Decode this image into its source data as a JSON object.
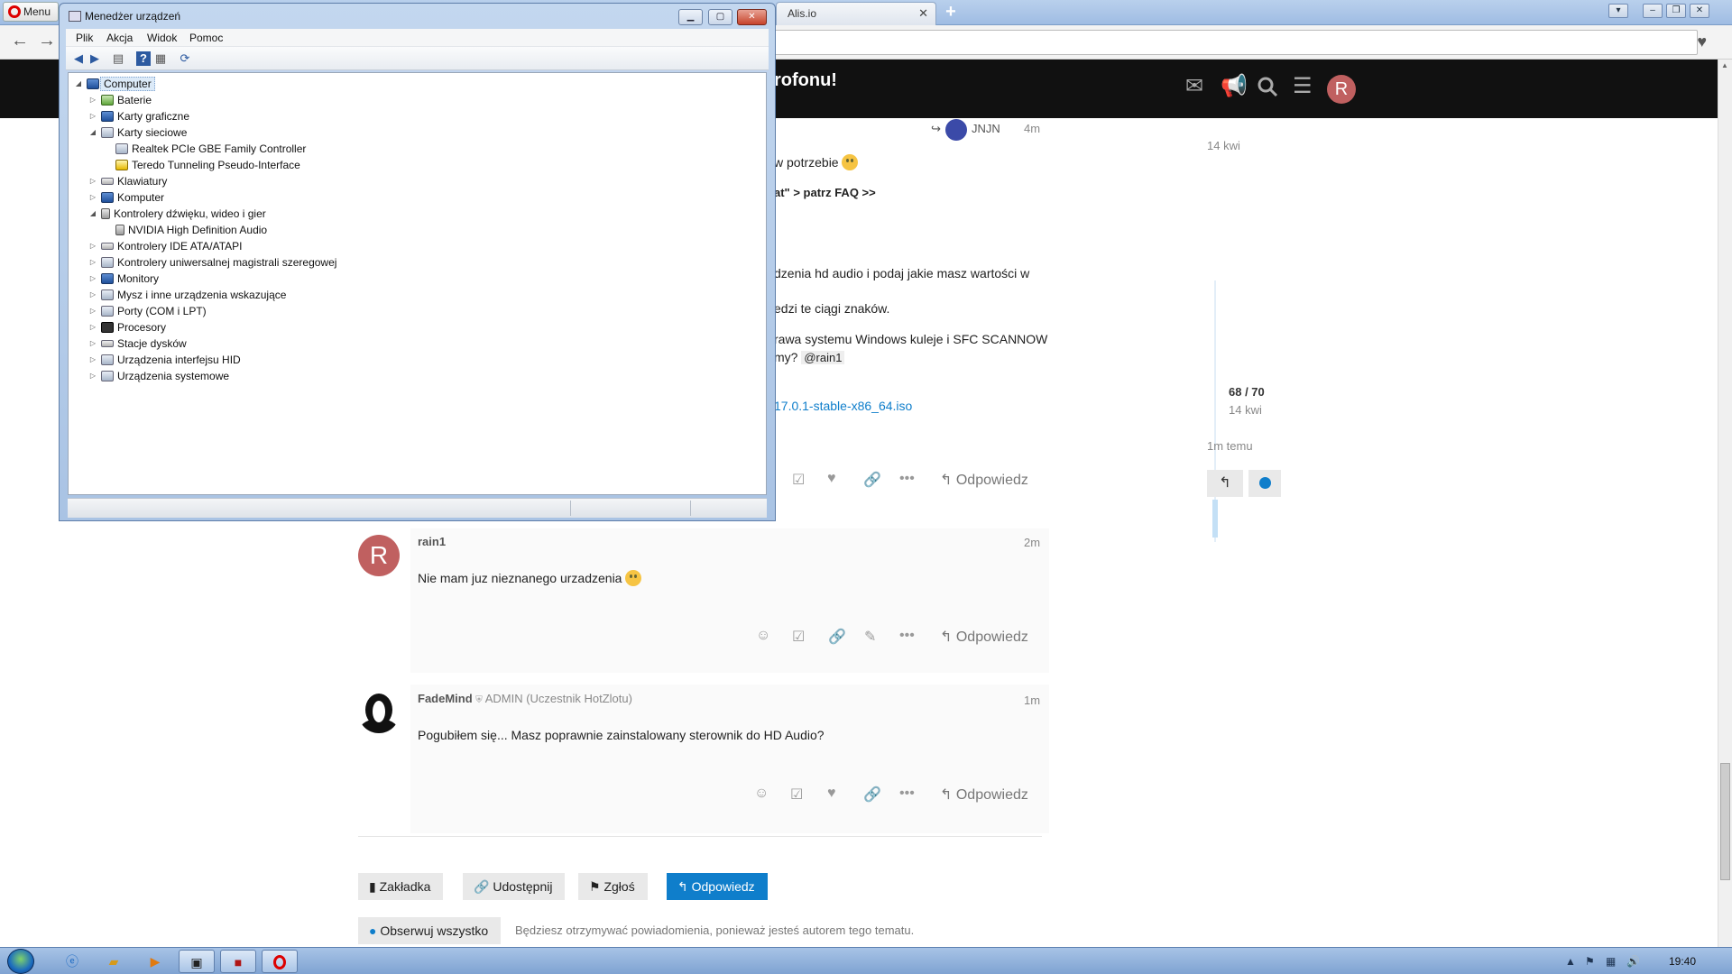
{
  "browser": {
    "menu_label": "Menu",
    "tabs": [
      {
        "title": ""
      },
      {
        "title": "Alis.io"
      }
    ],
    "newtab_label": "+"
  },
  "forum": {
    "topic_title": "rofonu!",
    "avatar_letter": "R",
    "first_post": {
      "user": "JNJN",
      "age": "4m",
      "lines": [
        "w potrzebie",
        "at\" > patrz FAQ >>",
        "dzenia hd audio i podaj jakie masz wartości w",
        "edzi te ciągi znaków.",
        "rawa systemu Windows kuleje i SFC SCANNOW",
        "my?"
      ],
      "mention": "@rain1",
      "link": "17.0.1-stable-x86_64.iso",
      "reply_label": "Odpowiedz"
    },
    "posts": [
      {
        "avatar": "R",
        "user": "rain1",
        "role": "",
        "age": "2m",
        "text": "Nie mam juz nieznanego urzadzenia",
        "reply_label": "Odpowiedz"
      },
      {
        "avatar": "",
        "user": "FadeMind",
        "role": "ADMIN (Uczestnik HotZlotu)",
        "age": "1m",
        "text": "Pogubiłem się... Masz poprawnie zainstalowany sterownik do HD Audio?",
        "reply_label": "Odpowiedz"
      }
    ],
    "footer_buttons": {
      "bookmark": "Zakładka",
      "share": "Udostępnij",
      "flag": "Zgłoś",
      "reply": "Odpowiedz"
    },
    "watch_button": "Obserwuj wszystko",
    "watch_note": "Będziesz otrzymywać powiadomienia, ponieważ jesteś autorem tego tematu."
  },
  "timeline": {
    "top_date": "14 kwi",
    "position": "68 / 70",
    "position_date": "14 kwi",
    "last_activity": "1m temu"
  },
  "device_manager": {
    "title": "Menedżer urządzeń",
    "menu": [
      "Plik",
      "Akcja",
      "Widok",
      "Pomoc"
    ],
    "tree": [
      {
        "label": "Computer",
        "level": 0,
        "toggle": "◢",
        "icon": "computer-icon"
      },
      {
        "label": "Baterie",
        "level": 1,
        "toggle": "▷",
        "icon": "battery-icon"
      },
      {
        "label": "Karty graficzne",
        "level": 1,
        "toggle": "▷",
        "icon": "display-adapter-icon"
      },
      {
        "label": "Karty sieciowe",
        "level": 1,
        "toggle": "◢",
        "icon": "network-adapter-icon"
      },
      {
        "label": "Realtek PCIe GBE Family Controller",
        "level": 2,
        "toggle": "",
        "icon": "network-adapter-icon"
      },
      {
        "label": "Teredo Tunneling Pseudo-Interface",
        "level": 2,
        "toggle": "",
        "icon": "network-warning-icon"
      },
      {
        "label": "Klawiatury",
        "level": 1,
        "toggle": "▷",
        "icon": "keyboard-icon"
      },
      {
        "label": "Komputer",
        "level": 1,
        "toggle": "▷",
        "icon": "computer-icon"
      },
      {
        "label": "Kontrolery dźwięku, wideo i gier",
        "level": 1,
        "toggle": "◢",
        "icon": "speaker-icon"
      },
      {
        "label": "NVIDIA High Definition Audio",
        "level": 2,
        "toggle": "",
        "icon": "speaker-icon"
      },
      {
        "label": "Kontrolery IDE ATA/ATAPI",
        "level": 1,
        "toggle": "▷",
        "icon": "ide-controller-icon"
      },
      {
        "label": "Kontrolery uniwersalnej magistrali szeregowej",
        "level": 1,
        "toggle": "▷",
        "icon": "usb-icon"
      },
      {
        "label": "Monitory",
        "level": 1,
        "toggle": "▷",
        "icon": "monitor-icon"
      },
      {
        "label": "Mysz i inne urządzenia wskazujące",
        "level": 1,
        "toggle": "▷",
        "icon": "mouse-icon"
      },
      {
        "label": "Porty (COM i LPT)",
        "level": 1,
        "toggle": "▷",
        "icon": "port-icon"
      },
      {
        "label": "Procesory",
        "level": 1,
        "toggle": "▷",
        "icon": "processor-icon"
      },
      {
        "label": "Stacje dysków",
        "level": 1,
        "toggle": "▷",
        "icon": "disk-drive-icon"
      },
      {
        "label": "Urządzenia interfejsu HID",
        "level": 1,
        "toggle": "▷",
        "icon": "hid-icon"
      },
      {
        "label": "Urządzenia systemowe",
        "level": 1,
        "toggle": "▷",
        "icon": "system-device-icon"
      }
    ]
  },
  "taskbar": {
    "clock": "19:40"
  },
  "colors": {
    "forum_header": "#111111",
    "primary_blue": "#0f7ecb",
    "avatar_red": "#c06060"
  }
}
